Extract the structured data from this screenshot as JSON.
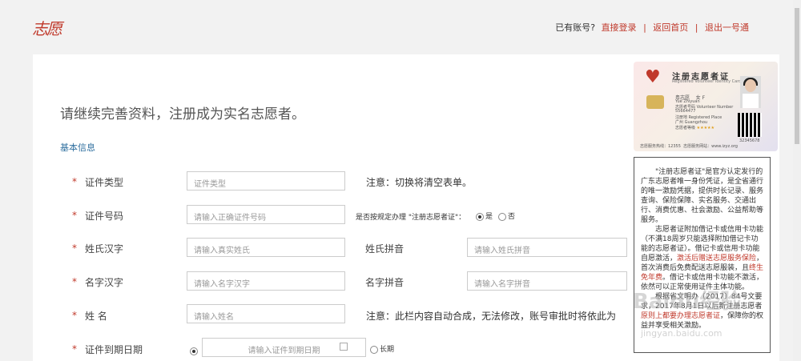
{
  "logo_text": "志愿",
  "toplinks": {
    "has_account": "已有账号?",
    "login": "直接登录",
    "home": "返回首页",
    "logout": "退出一号通"
  },
  "heading": "请继续完善资料，注册成为实名志愿者。",
  "section_title": "基本信息",
  "form": {
    "id_type": {
      "label": "证件类型",
      "placeholder": "证件类型",
      "note": "注意：切换将清空表单。"
    },
    "id_number": {
      "label": "证件号码",
      "placeholder": "请输入正确证件号码",
      "question": "是否按规定办理 \"注册志愿者证\"：",
      "yes": "是",
      "no": "否"
    },
    "surname": {
      "label": "姓氏汉字",
      "placeholder": "请输入真实姓氏",
      "pinyin_label": "姓氏拼音",
      "pinyin_placeholder": "请输入姓氏拼音"
    },
    "given_name": {
      "label": "名字汉字",
      "placeholder": "请输入名字汉字",
      "pinyin_label": "名字拼音",
      "pinyin_placeholder": "请输入名字拼音"
    },
    "full_name": {
      "label": "姓 名",
      "placeholder": "请输入姓名",
      "note": "注意：此栏内容自动合成，无法修改，账号审批时将依此为"
    },
    "expiry": {
      "label": "证件到期日期",
      "placeholder": "请输入证件到期日期",
      "long_term": "长期"
    }
  },
  "card": {
    "title": "注册志愿者证",
    "subtitle": "Registered Volunteer Identity Card",
    "name": "粤志愿",
    "gender": "女 F",
    "name_en": "Yue Zhiyuan",
    "volunteer_no_label": "志愿者号码 Volunteer Number",
    "volunteer_no": "55664477",
    "place_label": "注册地 Registered Place",
    "place": "广州 Guangzhou",
    "level_label": "志愿者等级",
    "hotline": "志愿服务热线：12355",
    "website": "志愿服务网站：www.izyz.org",
    "serial": "32345678"
  },
  "description": [
    {
      "text": "\"注册志愿者证\"是官方认定发行的广东志愿者唯一身份凭证，是全省通行的唯一激励凭据，提供时长记录、服务查询、保险保障、实名服务、交通出行、消费优惠、社会激励、公益帮助等服务。",
      "highlight": ""
    },
    {
      "text": "志愿者证附加借记卡或信用卡功能（不满18周岁只能选择附加借记卡功能的志愿者证）。借记卡或信用卡功能自愿激活，",
      "highlight": "激活后赠送志愿服务保险"
    },
    {
      "text": "，首次消费后免费配送志愿服装，且",
      "highlight": "终生免年费"
    },
    {
      "text": "。借记卡或信用卡功能不激活，依然可以正常使用证件主体功能。",
      "highlight": ""
    },
    {
      "text": "根据省文明办〔2017〕84号文要求，2017年8月1日以后新注册志愿者",
      "highlight": "原则上都要办理志愿者证"
    },
    {
      "text": "，保障你的权益并享受相关激励。",
      "highlight": ""
    }
  ],
  "watermark": "Baidu经验",
  "watermark_sub": "jingyan.baidu.com",
  "colors": {
    "accent": "#c0392b",
    "link": "#2f6f9f"
  }
}
